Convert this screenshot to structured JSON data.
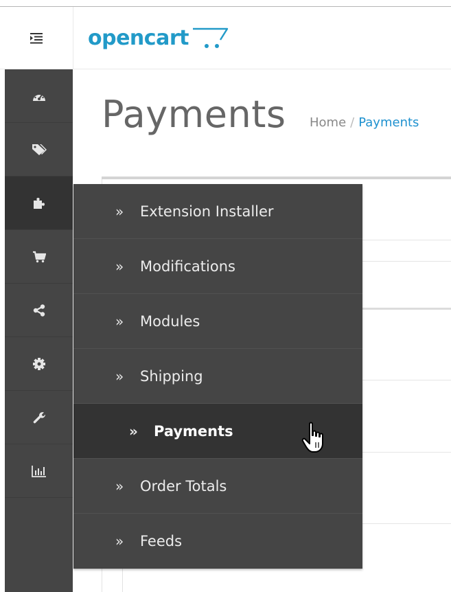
{
  "header": {
    "logo_text": "opencart",
    "menu_toggle_icon": "indent-icon"
  },
  "sidebar": {
    "icons": [
      {
        "name": "dashboard-icon",
        "active": false
      },
      {
        "name": "tags-icon",
        "active": false
      },
      {
        "name": "puzzle-icon",
        "active": true
      },
      {
        "name": "shopping-cart-icon",
        "active": false
      },
      {
        "name": "share-icon",
        "active": false
      },
      {
        "name": "cog-icon",
        "active": false
      },
      {
        "name": "wrench-icon",
        "active": false
      },
      {
        "name": "bar-chart-icon",
        "active": false
      }
    ]
  },
  "page": {
    "title": "Payments",
    "breadcrumb": {
      "home": "Home",
      "separator": "/",
      "current": "Payments"
    }
  },
  "flyout": {
    "chevron": "»",
    "items": [
      {
        "label": "Extension Installer",
        "active": false
      },
      {
        "label": "Modifications",
        "active": false
      },
      {
        "label": "Modules",
        "active": false
      },
      {
        "label": "Shipping",
        "active": false
      },
      {
        "label": "Payments",
        "active": true
      },
      {
        "label": "Order Totals",
        "active": false
      },
      {
        "label": "Feeds",
        "active": false
      }
    ]
  },
  "colors": {
    "sidebar_bg": "#454545",
    "sidebar_active_bg": "#333333",
    "brand": "#229ac8",
    "link": "#1e91cf"
  }
}
